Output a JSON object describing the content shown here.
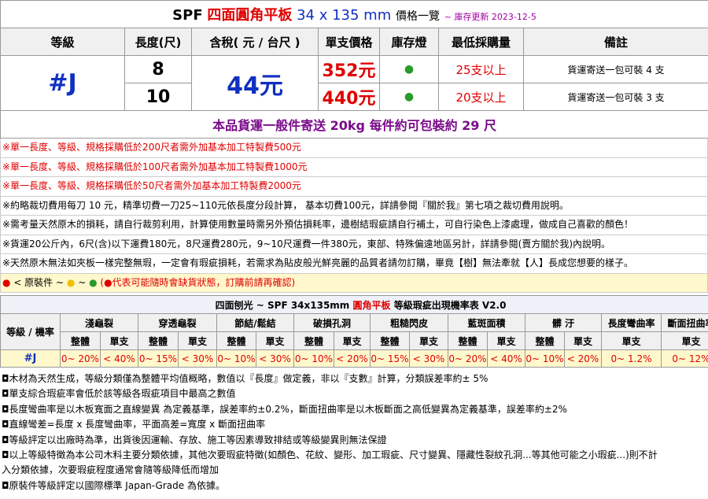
{
  "title": {
    "brand": "SPF",
    "product": "四面圓角平板",
    "size": "34 x 135 mm",
    "suffix": "價格一覽",
    "updated": "~ 庫存更新 2023-12-5"
  },
  "headers": [
    "等級",
    "長度(尺)",
    "含稅( 元 / 台尺 )",
    "單支價格",
    "庫存燈",
    "最低採購量",
    "備註"
  ],
  "grade": "#J",
  "price_per_ft": "44元",
  "rows": [
    {
      "length": "8",
      "unit_price": "352元",
      "stock": "●",
      "min_qty": "25支以上",
      "note": "貨運寄送一包可裝 4 支"
    },
    {
      "length": "10",
      "unit_price": "440元",
      "stock": "●",
      "min_qty": "20支以上",
      "note": "貨運寄送一包可裝 3 支"
    }
  ],
  "shipping": "本品貨運一般件寄送 20kg 每件約可包裝約 29 尺",
  "notes": [
    "※單一長度、等級、規格採購低於200尺者需外加基本加工特製費500元",
    "※單一長度、等級、規格採購低於100尺者需外加基本加工特製費1000元",
    "※單一長度、等級、規格採購低於50尺者需外加基本加工特製費2000元",
    "※約略裁切費用每刀 10 元，精準切費一刀25~110元依長度分段計算， 基本切費100元，詳請參閱『關於我』第七項之裁切費用說明。",
    "※需考量天然原木的損耗，請自行裁剪利用，計算使用數量時需另外預估損耗率，邊樹結瑕疵請自行補土，可自行染色上漆處理，做成自己喜歡的顏色！",
    "※貨運20公斤內，6尺(含)以下運費180元，8尺運費280元，9~10尺運費一件380元，東部、特殊偏遠地區另計，詳請參閱(賣方關於我)內說明。",
    "※天然原木無法如夾板一樣完整無瑕，一定會有瑕疵損耗，若需求為貼皮般光鮮亮麗的品質者請勿訂購，畢竟【樹】無法牽就【人】長成您想要的樣子。"
  ],
  "legend": {
    "prefix": "< 原裝件 ~",
    "sep": "~",
    "suffix": "(●代表可能隨時會缺貨狀態，訂購前請再確認)",
    "colors": [
      "#e00000",
      "#f0c000",
      "#2a9a2a"
    ]
  },
  "defect_table": {
    "title_a": "四面刨光 ~ SPF 34x135mm",
    "title_b": "圓角平板",
    "title_c": "等級瑕疵出現機率表 V2.0",
    "corner": "等級 / 機率",
    "groups": [
      "淺龜裂",
      "穿透龜裂",
      "節結/鬆結",
      "破損孔洞",
      "粗糙閃皮",
      "藍斑面積",
      "髒 汙",
      "長度彎曲率",
      "斷面扭曲率"
    ],
    "sub_whole": "整體",
    "sub_single": "單支",
    "row_grade": "#J",
    "values": [
      "0~ 20%",
      "< 40%",
      "0~ 15%",
      "< 30%",
      "0~ 10%",
      "< 30%",
      "0~ 10%",
      "< 20%",
      "0~ 15%",
      "< 30%",
      "0~ 20%",
      "< 40%",
      "0~ 10%",
      "< 20%",
      "0~ 1.2%",
      "0~ 12%"
    ]
  },
  "footnotes": [
    "◘木材為天然生成，等級分類僅為整體平均值概略，數值以『長度』做定義，非以『支數』計算，分類誤差率約± 5%",
    "◘單支綜合瑕疵率會低於該等級各瑕疵項目中最高之數值",
    "◘長度彎曲率是以木板寬面之直線變異 為定義基準，誤差率約±0.2%，斷面扭曲率是以木板斷面之高低變異為定義基準，誤差率約±2%",
    "◘直線彎差=長度 x 長度彎曲率，平面高差=寬度 x 斷面扭曲率",
    "◘等級評定以出廠時為準，出貨後因運輸、存放、施工等因素導致排結或等級變異則無法保證",
    "◘以上等級特徵為本公司木料主要分類依據，其他次要瑕疵特徵(如顏色、花紋、變形、加工瑕疵、尺寸變異、隱藏性裂紋孔洞...等其他可能之小瑕疵...)則不計",
    "入分類依據，次要瑕疵程度通常會隨等級降低而增加",
    "◘原裝件等級評定以國際標準 Japan-Grade 為依據。"
  ]
}
